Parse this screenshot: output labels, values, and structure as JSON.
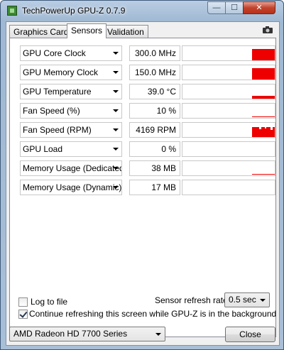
{
  "window": {
    "title": "TechPowerUp GPU-Z 0.7.9",
    "min_glyph": "—",
    "max_glyph": "☐",
    "close_glyph": "✕"
  },
  "tabs": [
    {
      "label": "Graphics Card",
      "active": false
    },
    {
      "label": "Sensors",
      "active": true
    },
    {
      "label": "Validation",
      "active": false
    }
  ],
  "sensors": [
    {
      "name": "GPU Core Clock",
      "value": "300.0 MHz",
      "graph": "full"
    },
    {
      "name": "GPU Memory Clock",
      "value": "150.0 MHz",
      "graph": "full"
    },
    {
      "name": "GPU Temperature",
      "value": "39.0 °C",
      "graph": "line-mid"
    },
    {
      "name": "Fan Speed (%)",
      "value": "10 %",
      "graph": "line-low"
    },
    {
      "name": "Fan Speed (RPM)",
      "value": "4169 RPM",
      "graph": "rpm"
    },
    {
      "name": "GPU Load",
      "value": "0 %",
      "graph": "empty"
    },
    {
      "name": "Memory Usage (Dedicated)",
      "value": "38 MB",
      "graph": "line-low"
    },
    {
      "name": "Memory Usage (Dynamic)",
      "value": "17 MB",
      "graph": "empty"
    }
  ],
  "options": {
    "log_to_file_label": "Log to file",
    "log_to_file_checked": false,
    "refresh_rate_label": "Sensor refresh rate:",
    "refresh_rate_value": "0.5 sec",
    "continue_refresh_label": "Continue refreshing this screen while GPU-Z is in the background",
    "continue_refresh_checked": true
  },
  "footer": {
    "gpu_select_value": "AMD Radeon HD 7700 Series",
    "close_label": "Close"
  },
  "colors": {
    "graph_bar": "#ee0000"
  }
}
